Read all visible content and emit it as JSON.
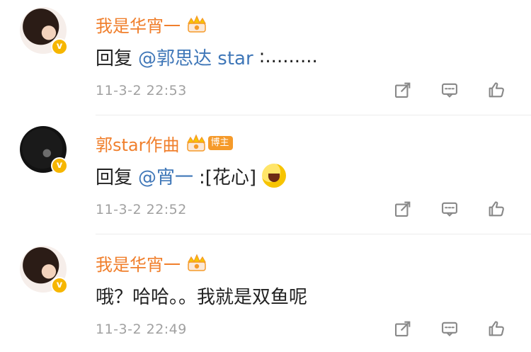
{
  "comments": [
    {
      "username": "我是华宵一",
      "reply_label": "回复",
      "mention": "@郭思达 star",
      "text": ":.........",
      "timestamp": "11-3-2 22:53"
    },
    {
      "username": "郭star作曲",
      "badge": "博主",
      "reply_label": "回复",
      "mention": "@宵一",
      "text": ":[花心]",
      "timestamp": "11-3-2 22:52"
    },
    {
      "username": "我是华宵一",
      "text": "哦？哈哈。。我就是双鱼呢",
      "timestamp": "11-3-2 22:49"
    }
  ],
  "icons": {
    "verified": "v",
    "crown": "crown-icon",
    "share": "share-icon",
    "comment": "comment-icon",
    "like": "like-icon"
  },
  "colors": {
    "username": "#f07f2c",
    "mention": "#3f77b8",
    "timestamp": "#a1a1a1",
    "badge": "#f59a2a",
    "verified_badge": "#f6b600"
  }
}
